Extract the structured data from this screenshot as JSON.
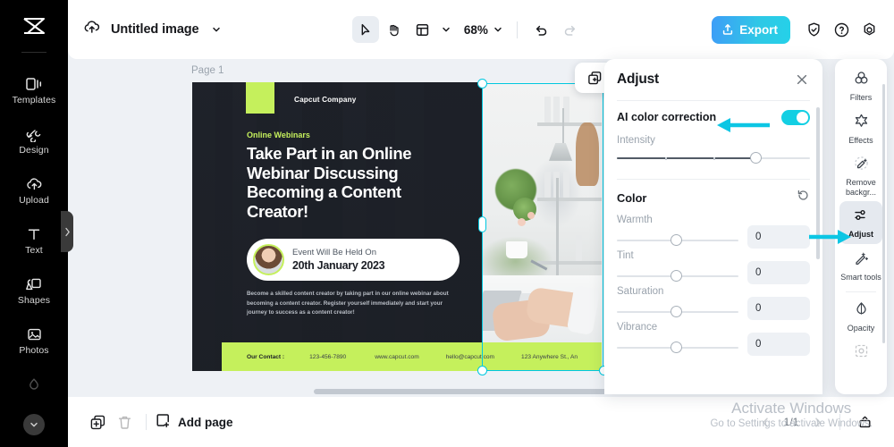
{
  "left_rail": {
    "logo": "capcut-logo",
    "items": [
      {
        "label": "Templates",
        "icon": "templates-icon"
      },
      {
        "label": "Design",
        "icon": "design-icon"
      },
      {
        "label": "Upload",
        "icon": "upload-cloud-icon"
      },
      {
        "label": "Text",
        "icon": "text-icon"
      },
      {
        "label": "Shapes",
        "icon": "shapes-icon"
      },
      {
        "label": "Photos",
        "icon": "photos-icon"
      }
    ],
    "collapse_icon": "chevron-down-icon",
    "flyout_icon": "chevron-right-icon"
  },
  "topbar": {
    "cloud_icon": "cloud-upload-icon",
    "doc_title": "Untitled image",
    "title_chevron": "chevron-down-icon",
    "cursor_tool": "cursor-arrow-icon",
    "hand_tool": "hand-icon",
    "layout_tool": "layout-icon",
    "layout_chevron": "chevron-down-icon",
    "zoom_value": "68%",
    "zoom_chevron": "chevron-down-icon",
    "undo_icon": "undo-icon",
    "redo_icon": "redo-icon",
    "export_label": "Export",
    "export_icon": "share-up-icon",
    "shield_icon": "shield-check-icon",
    "help_icon": "help-circle-icon",
    "settings_icon": "settings-gear-icon",
    "export_color": "#2ec8e6"
  },
  "canvas": {
    "page_label": "Page 1",
    "float_copy_icon": "duplicate-icon",
    "poster": {
      "company": "Capcut Company",
      "eyebrow": "Online Webinars",
      "headline": "Take Part in an Online Webinar Discussing Becoming a Content Creator!",
      "card_line1": "Event Will Be Held On",
      "card_line2": "20th January 2023",
      "body": "Become a skilled content creator by taking part in our online webinar about becoming a content creator. Register yourself immediately and start your journey to success as a content creator!",
      "contact_label": "Our Contact :",
      "contacts": [
        "123-456-7890",
        "www.capcut.com",
        "hello@capcut.com",
        "123 Anywhere St., An"
      ],
      "accent_green": "#c5f05c",
      "dark_bg": "#1c1f26"
    },
    "selection_color": "#00c8e0"
  },
  "adjust_panel": {
    "title": "Adjust",
    "close_icon": "close-x-icon",
    "ai_correction_label": "AI color correction",
    "ai_correction_on": true,
    "intensity_label": "Intensity",
    "intensity_percent": 75,
    "color_section_title": "Color",
    "reset_icon": "reset-arrow-icon",
    "sliders": [
      {
        "label": "Warmth",
        "value": "0",
        "percent": 50
      },
      {
        "label": "Tint",
        "value": "0",
        "percent": 50
      },
      {
        "label": "Saturation",
        "value": "0",
        "percent": 50
      },
      {
        "label": "Vibrance",
        "value": "0",
        "percent": 50
      }
    ],
    "toggle_color": "#13cfe3"
  },
  "right_rail": {
    "items": [
      {
        "label": "Filters",
        "icon": "filters-circles-icon",
        "selected": false
      },
      {
        "label": "Effects",
        "icon": "effects-star-icon",
        "selected": false
      },
      {
        "label": "Remove backgr...",
        "icon": "remove-background-icon",
        "selected": false
      },
      {
        "label": "Adjust",
        "icon": "adjust-sliders-icon",
        "selected": true
      },
      {
        "label": "Smart tools",
        "icon": "smart-tools-wand-icon",
        "selected": false
      },
      {
        "label": "Opacity",
        "icon": "opacity-drop-icon",
        "selected": false
      }
    ]
  },
  "bottombar": {
    "duplicate_icon": "duplicate-page-icon",
    "delete_icon": "trash-icon",
    "add_page_label": "Add page",
    "add_page_icon": "add-page-icon",
    "prev_icon": "chevron-left-icon",
    "page_indicator": "1/1",
    "next_icon": "chevron-right-icon",
    "grid_view_icon": "page-view-icon"
  },
  "watermark": {
    "line1": "Activate Windows",
    "line2": "Go to Settings to activate Windows."
  },
  "annotations": {
    "arrow_color": "#0cc6e4",
    "arrow_ai": "arrow-pointing-left-icon",
    "arrow_adjust": "arrow-pointing-right-icon"
  }
}
